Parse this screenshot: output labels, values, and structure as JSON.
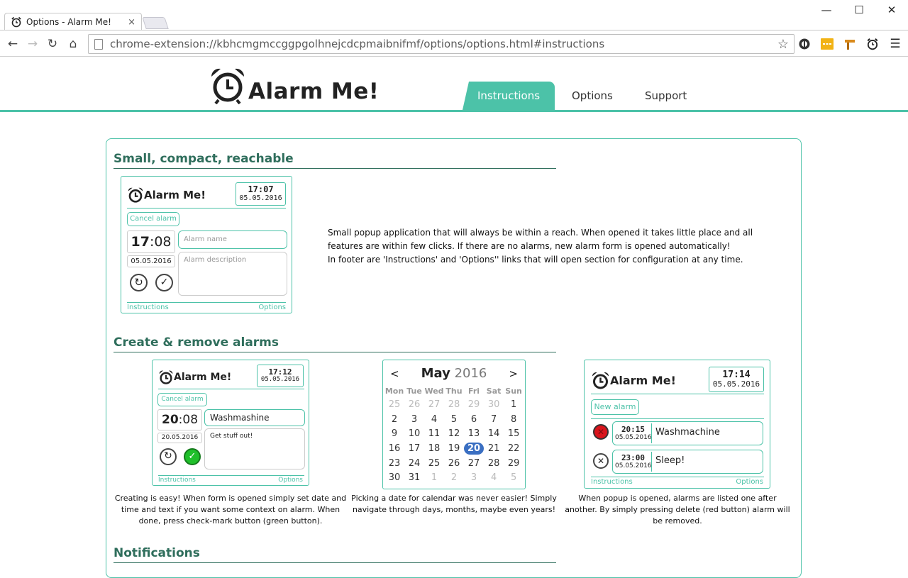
{
  "browser": {
    "tab_title": "Options - Alarm Me!",
    "tab_close": "×",
    "url": "chrome-extension://kbhcmgmccggpgolhnejcdcpmaibnifmf/options/options.html#instructions",
    "window": {
      "minimize": "—",
      "maximize": "☐",
      "close": "✕"
    }
  },
  "site": {
    "logo_text": "Alarm Me!",
    "nav": [
      {
        "label": "Instructions",
        "active": true
      },
      {
        "label": "Options"
      },
      {
        "label": "Support"
      }
    ],
    "accent_color": "#4cc2a8"
  },
  "sections": {
    "s1": {
      "title": "Small, compact, reachable",
      "desc": [
        "Small popup application that will always be within a reach. When opened it takes little place and all",
        "features are within few clicks. If there are no alarms, new alarm form is opened automatically!",
        "In footer are 'Instructions' and 'Options'' links that will open section for configuration at any time."
      ],
      "popup": {
        "logo": "Alarm Me!",
        "time": "17:07",
        "date": "05.05.2016",
        "cancel": "Cancel alarm",
        "hour": "17",
        "minute": ":08",
        "alarm_date": "05.05.2016",
        "name_placeholder": "Alarm name",
        "desc_placeholder": "Alarm description",
        "footer_left": "Instructions",
        "footer_right": "Options"
      }
    },
    "s2": {
      "title": "Create & remove alarms",
      "create": {
        "logo": "Alarm Me!",
        "time": "17:12",
        "date": "05.05.2016",
        "cancel": "Cancel alarm",
        "hour": "20",
        "minute": ":08",
        "alarm_date": "20.05.2016",
        "name": "Washmashine",
        "desc": "Get stuff out!",
        "footer_left": "Instructions",
        "footer_right": "Options",
        "caption": [
          "Creating is easy! When form is opened simply set date and",
          "time and text if you want some context on alarm. When",
          "done, press check-mark button (green button)."
        ]
      },
      "calendar": {
        "month": "May",
        "year": "2016",
        "prev": "<",
        "next": ">",
        "weekdays": [
          "Mon",
          "Tue",
          "Wed",
          "Thu",
          "Fri",
          "Sat",
          "Sun"
        ],
        "weeks": [
          [
            "25",
            "26",
            "27",
            "28",
            "29",
            "30",
            "1"
          ],
          [
            "2",
            "3",
            "4",
            "5",
            "6",
            "7",
            "8"
          ],
          [
            "9",
            "10",
            "11",
            "12",
            "13",
            "14",
            "15"
          ],
          [
            "16",
            "17",
            "18",
            "19",
            "20",
            "21",
            "22"
          ],
          [
            "23",
            "24",
            "25",
            "26",
            "27",
            "28",
            "29"
          ],
          [
            "30",
            "31",
            "1",
            "2",
            "3",
            "4",
            "5"
          ]
        ],
        "selected": "20",
        "caption": [
          "Picking a date for calendar was never easier! Simply",
          "navigate through days, months, maybe even years!"
        ]
      },
      "list": {
        "logo": "Alarm Me!",
        "time": "17:14",
        "date": "05.05.2016",
        "new_alarm": "New alarm",
        "alarms": [
          {
            "time": "20:15",
            "date": "05.05.2016",
            "name": "Washmachine"
          },
          {
            "time": "23:00",
            "date": "05.05.2016",
            "name": "Sleep!"
          }
        ],
        "footer_left": "Instructions",
        "footer_right": "Options",
        "caption": [
          "When popup is opened, alarms are listed one after",
          "another. By simply pressing delete (red button) alarm will",
          "be removed."
        ]
      }
    },
    "s3": {
      "title": "Notifications"
    }
  }
}
